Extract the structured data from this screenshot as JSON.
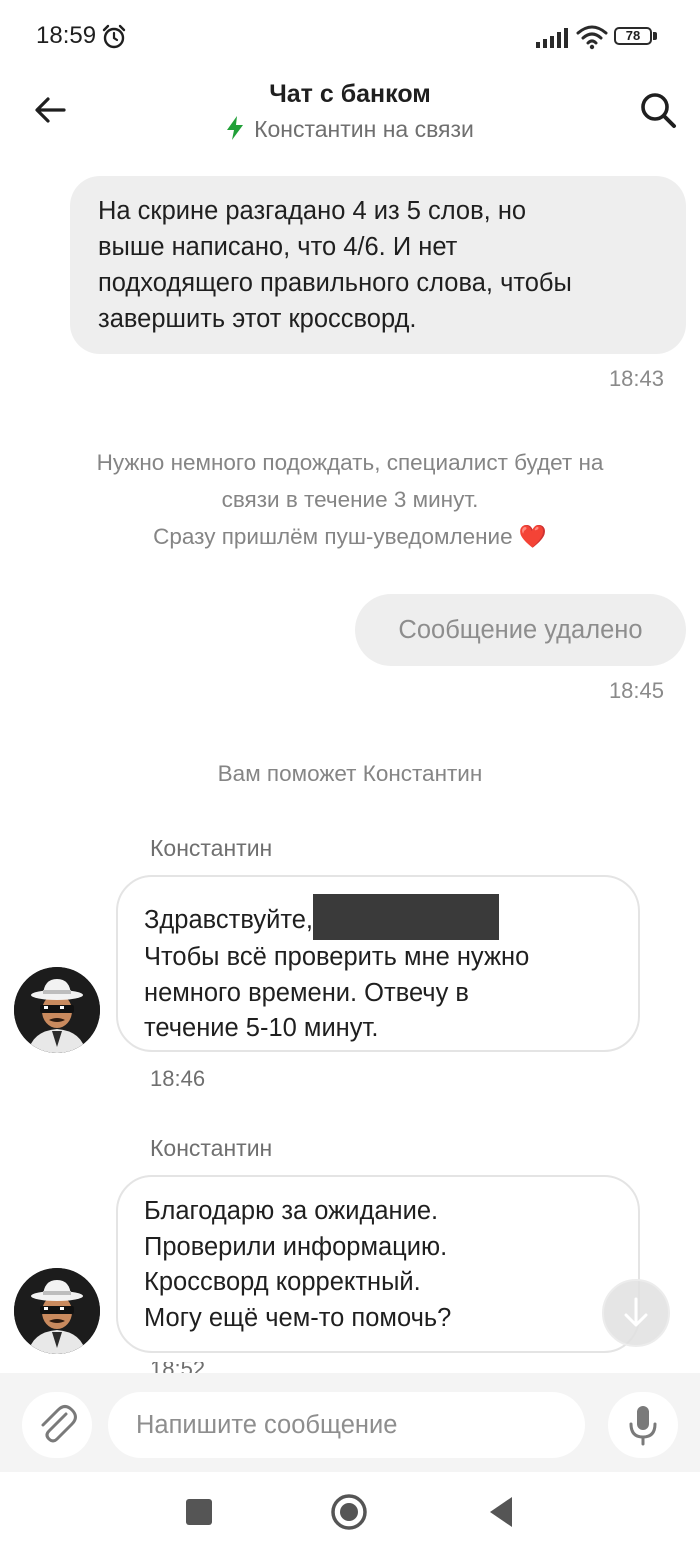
{
  "status_bar": {
    "time": "18:59",
    "battery": "78"
  },
  "header": {
    "title": "Чат с банком",
    "subtitle": "Константин на связи"
  },
  "messages": {
    "m1": {
      "lines": [
        "На скрине разгадано 4 из 5 слов, но",
        "выше написано, что 4/6. И нет",
        "подходящего правильного слова, чтобы",
        "завершить этот кроссворд."
      ],
      "time": "18:43"
    },
    "system1": {
      "lines": [
        "Нужно немного подождать, специалист будет на",
        "связи в течение 3 минут.",
        "Сразу пришлём пуш-уведомление ❤️"
      ]
    },
    "m2": {
      "text": "Сообщение удалено",
      "time": "18:45"
    },
    "system2": {
      "text": "Вам поможет Константин"
    },
    "m3": {
      "sender": "Константин",
      "greeting": "Здравствуйте,",
      "lines": [
        "Чтобы всё проверить мне нужно",
        "немного времени. Отвечу в",
        "течение 5-10 минут."
      ],
      "time": "18:46"
    },
    "m4": {
      "sender": "Константин",
      "lines": [
        "Благодарю за ожидание.",
        "Проверили информацию.",
        "Кроссворд корректный.",
        "Могу ещё чем-то помочь?"
      ],
      "time": "18:52"
    }
  },
  "composer": {
    "placeholder": "Напишите сообщение"
  },
  "colors": {
    "accent_green": "#21a038",
    "bubble_out": "#eeeeee",
    "muted_text": "#858585"
  },
  "icons": [
    "alarm-icon",
    "signal-icon",
    "wifi-icon",
    "back-arrow-icon",
    "search-icon",
    "lightning-icon",
    "paperclip-icon",
    "microphone-icon",
    "arrow-down-icon",
    "square-icon",
    "home-circle-icon",
    "back-triangle-icon"
  ]
}
